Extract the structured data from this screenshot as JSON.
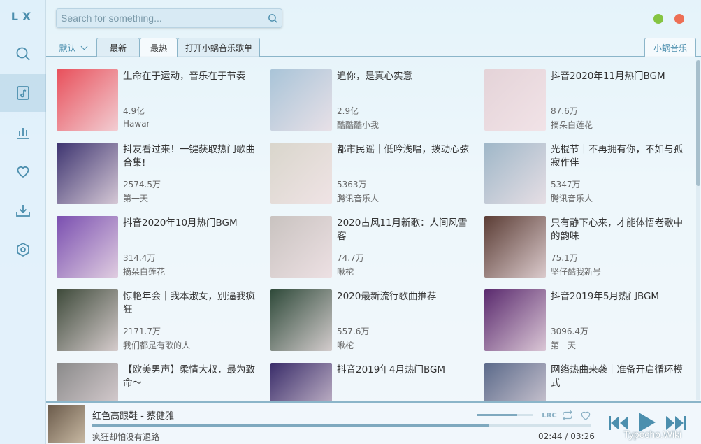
{
  "app": {
    "logo": "LX"
  },
  "sidebar": {
    "items": [
      {
        "icon": "search-icon"
      },
      {
        "icon": "song-list-icon",
        "active": true
      },
      {
        "icon": "chart-icon"
      },
      {
        "icon": "heart-icon"
      },
      {
        "icon": "download-icon"
      },
      {
        "icon": "settings-icon"
      }
    ]
  },
  "search": {
    "placeholder": "Search for something..."
  },
  "tabs": {
    "sort_label": "默认",
    "items": [
      "最新",
      "最热",
      "打开小蜗音乐歌单"
    ],
    "active_index": 1,
    "source": "小蜗音乐"
  },
  "playlists": [
    {
      "title": "生命在于运动，音乐在于节奏",
      "plays": "4.9亿",
      "author": "Hawar",
      "color": "#e8505b"
    },
    {
      "title": "追你，是真心实意",
      "plays": "2.9亿",
      "author": "酷酷酷小我",
      "color": "#a9c4d8"
    },
    {
      "title": "抖音2020年11月热门BGM",
      "plays": "87.6万",
      "author": "摘朵白莲花",
      "color": "#e4d3d8"
    },
    {
      "title": "抖友看过来！一键获取热门歌曲合集!",
      "plays": "2574.5万",
      "author": "第一天",
      "color": "#3d3470"
    },
    {
      "title": "都市民谣｜低吟浅唱，拨动心弦",
      "plays": "5363万",
      "author": "腾讯音乐人",
      "color": "#d9d6cc"
    },
    {
      "title": "光棍节｜不再拥有你，不如与孤寂作伴",
      "plays": "5347万",
      "author": "腾讯音乐人",
      "color": "#9fb7c8"
    },
    {
      "title": "抖音2020年10月热门BGM",
      "plays": "314.4万",
      "author": "摘朵白莲花",
      "color": "#7a4fb0"
    },
    {
      "title": "2020古风11月新歌：人间风雪客",
      "plays": "74.7万",
      "author": "啾柁",
      "color": "#c9c3c0"
    },
    {
      "title": "只有静下心来，才能体悟老歌中的韵味",
      "plays": "75.1万",
      "author": "坚仔酷我新号",
      "color": "#5b3d35"
    },
    {
      "title": "惊艳年会｜我本淑女，别逼我疯狂",
      "plays": "2171.7万",
      "author": "我们都是有歌的人",
      "color": "#3e4a3a"
    },
    {
      "title": "2020最新流行歌曲推荐",
      "plays": "557.6万",
      "author": "啾柁",
      "color": "#2f4a3a"
    },
    {
      "title": "抖音2019年5月热门BGM",
      "plays": "3096.4万",
      "author": "第一天",
      "color": "#5a2a6e"
    },
    {
      "title": "【欧美男声】柔情大叔，最为致命～",
      "plays": "",
      "author": "",
      "color": "#8a8a8a"
    },
    {
      "title": "抖音2019年4月热门BGM",
      "plays": "",
      "author": "",
      "color": "#3a2d6a"
    },
    {
      "title": "网络热曲来袭｜准备开启循环模式",
      "plays": "",
      "author": "",
      "color": "#5b6a8a"
    }
  ],
  "player": {
    "song": "红色高跟鞋 - 蔡健雅",
    "lyric": "疯狂却怕没有退路",
    "time": "02:44 / 03:26",
    "progress": 0.796,
    "volume": 0.72,
    "lrc_label": "LRC",
    "watermark": "Typecho.Wiki",
    "cover_color": "#6a5a4a"
  }
}
